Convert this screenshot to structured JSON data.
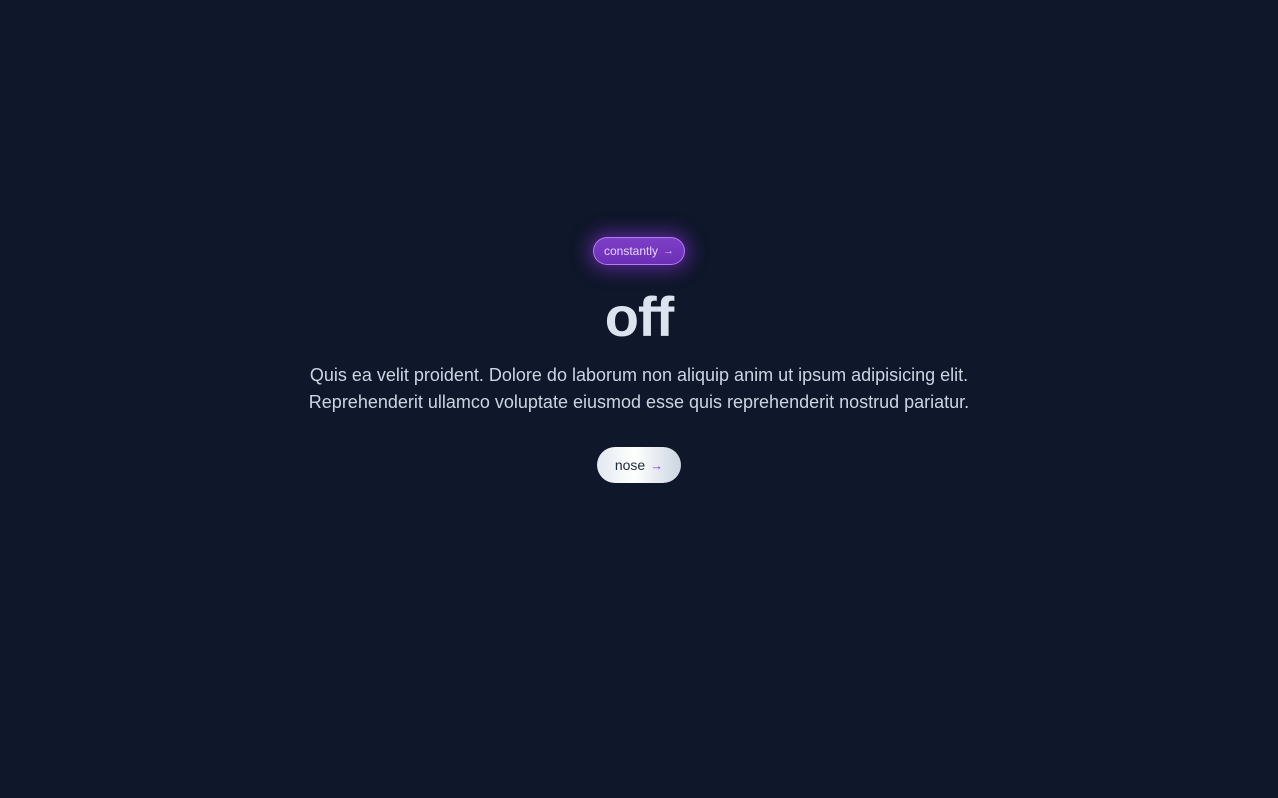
{
  "hero": {
    "badge": {
      "label": "constantly",
      "icon": "arrow-right-icon",
      "arrow_glyph": "→"
    },
    "headline": "off",
    "description_lines": [
      "Quis ea velit proident. Dolore do laborum non aliquip anim ut ipsum adipisicing elit.",
      "Reprehenderit ullamco voluptate eiusmod esse quis reprehenderit nostrud pariatur."
    ],
    "cta": {
      "label": "nose",
      "icon": "arrow-right-icon",
      "arrow_glyph": "→"
    }
  },
  "colors": {
    "background": "#0f172a",
    "accent": "#9333ea",
    "headline": "#dbe3ee",
    "body_text": "#cbd5e1"
  }
}
